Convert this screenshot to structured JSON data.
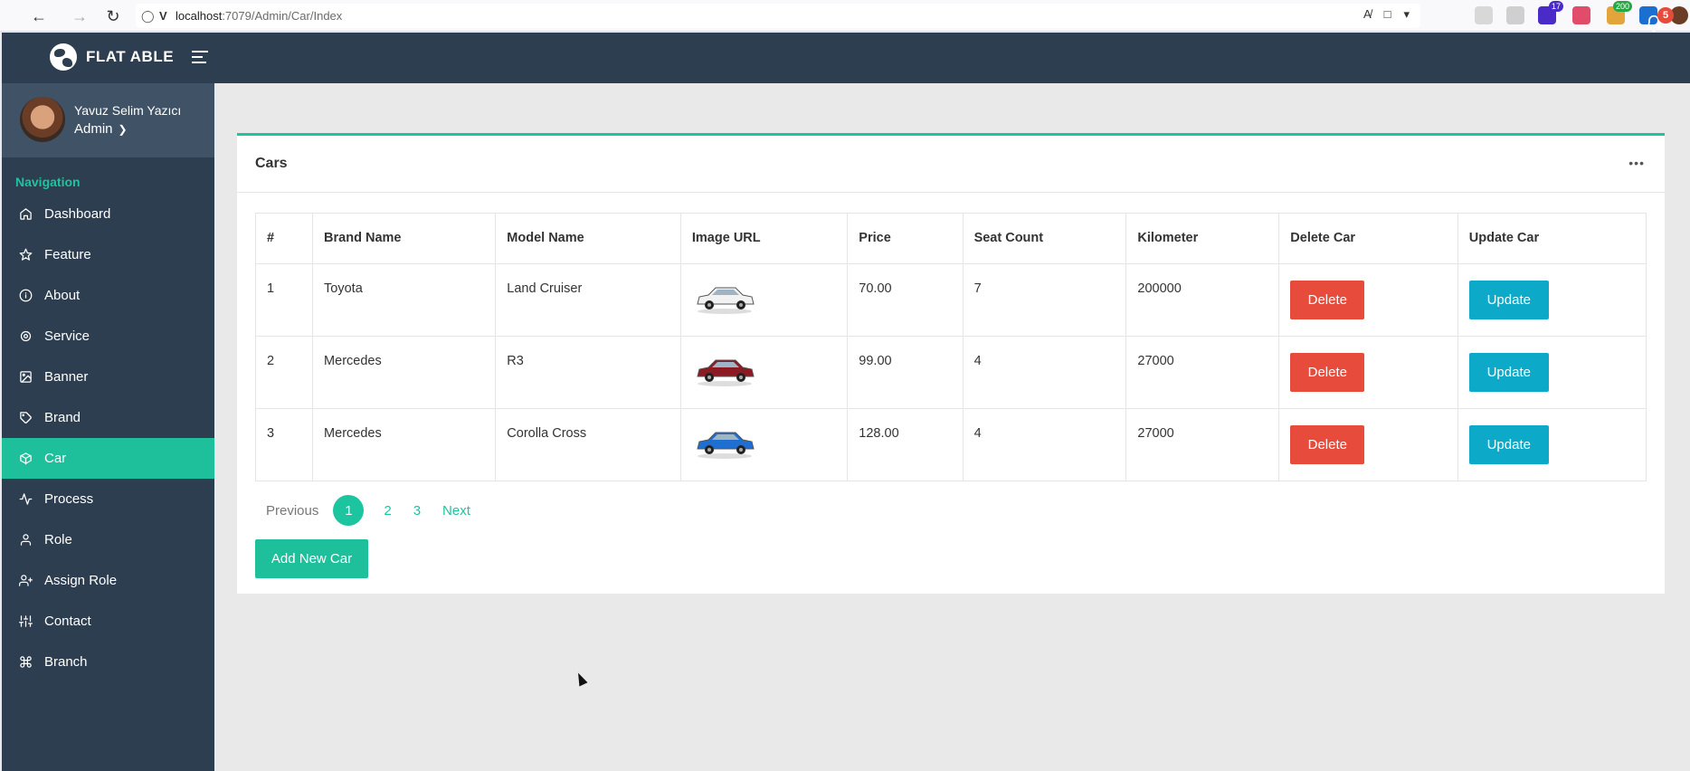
{
  "browser": {
    "url_host": "localhost",
    "url_path": ":7079/Admin/Car/Index",
    "ext_badges": [
      "17",
      "200"
    ]
  },
  "app": {
    "title": "FLAT ABLE",
    "notification_count": "5"
  },
  "user": {
    "name": "Yavuz Selim Yazıcı",
    "role": "Admin"
  },
  "sidebar": {
    "heading": "Navigation",
    "items": [
      {
        "label": "Dashboard",
        "icon": "home-icon",
        "active": false
      },
      {
        "label": "Feature",
        "icon": "star-icon",
        "active": false
      },
      {
        "label": "About",
        "icon": "info-icon",
        "active": false
      },
      {
        "label": "Service",
        "icon": "gear-icon",
        "active": false
      },
      {
        "label": "Banner",
        "icon": "image-icon",
        "active": false
      },
      {
        "label": "Brand",
        "icon": "tag-icon",
        "active": false
      },
      {
        "label": "Car",
        "icon": "box-icon",
        "active": true
      },
      {
        "label": "Process",
        "icon": "activity-icon",
        "active": false
      },
      {
        "label": "Role",
        "icon": "user-icon",
        "active": false
      },
      {
        "label": "Assign Role",
        "icon": "user-plus-icon",
        "active": false
      },
      {
        "label": "Contact",
        "icon": "sliders-icon",
        "active": false
      },
      {
        "label": "Branch",
        "icon": "command-icon",
        "active": false
      }
    ]
  },
  "card": {
    "title": "Cars",
    "more": "•••"
  },
  "table": {
    "headers": [
      "#",
      "Brand Name",
      "Model Name",
      "Image URL",
      "Price",
      "Seat Count",
      "Kilometer",
      "Delete Car",
      "Update Car"
    ],
    "rows": [
      {
        "no": "1",
        "brand": "Toyota",
        "model": "Land Cruiser",
        "price": "70.00",
        "seats": "7",
        "km": "200000",
        "car_color": "#f2f2f2"
      },
      {
        "no": "2",
        "brand": "Mercedes",
        "model": "R3",
        "price": "99.00",
        "seats": "4",
        "km": "27000",
        "car_color": "#8b1a22"
      },
      {
        "no": "3",
        "brand": "Mercedes",
        "model": "Corolla Cross",
        "price": "128.00",
        "seats": "4",
        "km": "27000",
        "car_color": "#1f6fd1"
      }
    ],
    "delete_label": "Delete",
    "update_label": "Update"
  },
  "pagination": {
    "previous": "Previous",
    "pages": [
      "1",
      "2",
      "3"
    ],
    "current": "1",
    "next": "Next"
  },
  "actions": {
    "add_new": "Add New Car"
  },
  "colors": {
    "brand_teal": "#1dc4a0",
    "navy": "#2d3e50",
    "delete_red": "#e64b3b",
    "update_cyan": "#0ca9c8"
  }
}
